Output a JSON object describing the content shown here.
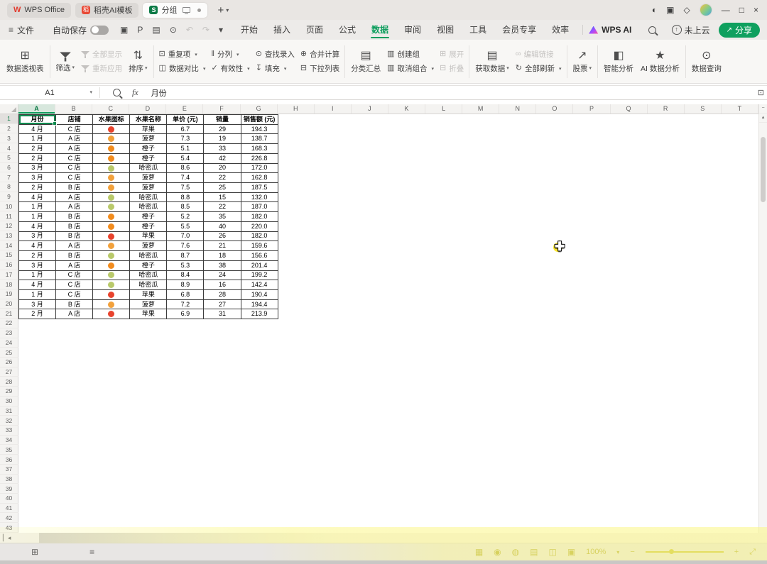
{
  "colors": {
    "accent_green": "#0f9e5e",
    "dark_green": "#0b7a45",
    "selection_green": "#0e8a4f",
    "table_border": "#3c3c3c",
    "fruit": {
      "apple": "#e8432d",
      "pineapple": "#f2a13c",
      "orange": "#f28c1e",
      "melon": "#b9c96a"
    }
  },
  "title_bar": {
    "tabs": [
      {
        "label": "WPS Office",
        "icon": "wps-logo",
        "active": false,
        "badges": []
      },
      {
        "label": "稻壳AI模板",
        "icon": "docer-logo",
        "active": false,
        "badges": []
      },
      {
        "label": "分组",
        "icon": "sheet-doc-logo",
        "active": true,
        "badges": [
          "monitor-icon",
          "unsaved-dot"
        ]
      }
    ],
    "new_tab_glyph": "+",
    "tab_list_caret": "▾",
    "window_icons": [
      {
        "name": "theme-icon",
        "glyph": "◐"
      },
      {
        "name": "layout-icon",
        "glyph": "▣"
      },
      {
        "name": "3d-box-icon",
        "glyph": "◇"
      },
      {
        "name": "avatar",
        "glyph": ""
      },
      {
        "name": "minimize-button",
        "glyph": "—"
      },
      {
        "name": "maximize-button",
        "glyph": "□"
      },
      {
        "name": "close-button",
        "glyph": "×"
      }
    ]
  },
  "menu_bar": {
    "file_label": "文件",
    "autosave_label": "自动保存",
    "quick_access": [
      {
        "name": "save-icon",
        "glyph": "▣",
        "disabled": false
      },
      {
        "name": "export-pdf-icon",
        "glyph": "P",
        "disabled": false
      },
      {
        "name": "print-icon",
        "glyph": "▤",
        "disabled": false
      },
      {
        "name": "print-preview-icon",
        "glyph": "⊙",
        "disabled": false
      },
      {
        "name": "undo-icon",
        "glyph": "↶",
        "disabled": true
      },
      {
        "name": "redo-icon",
        "glyph": "↷",
        "disabled": true
      },
      {
        "name": "quick-access-caret",
        "glyph": "▾",
        "disabled": false
      }
    ],
    "items": [
      "开始",
      "插入",
      "页面",
      "公式",
      "数据",
      "审阅",
      "视图",
      "工具",
      "会员专享",
      "效率"
    ],
    "active_item": "数据",
    "wps_ai_label": "WPS AI",
    "cloud_status": "未上云",
    "share_label": "分享"
  },
  "icon_glyphs": {
    "pivot-table": "⊞",
    "sort": "⇅",
    "duplicates": "⊡",
    "data-compare": "◫",
    "text-to-columns": "‖",
    "validation": "✓",
    "find-entry": "⊙",
    "fill": "↧",
    "consolidate": "⊕",
    "dropdown-list": "⊟",
    "subtotal": "▤",
    "create-group": "▥",
    "ungroup": "▥",
    "expand": "⊞",
    "collapse": "⊟",
    "get-data": "▤",
    "edit-links": "∞",
    "refresh-all": "↻",
    "stock": "↗",
    "smart-analysis": "◧",
    "ai-analysis": "★",
    "data-query": "⊙"
  },
  "ribbon": {
    "buttons": [
      {
        "kind": "big",
        "icon": "pivot-table",
        "label": "数据透视表",
        "arrow": false
      },
      {
        "kind": "sep"
      },
      {
        "kind": "big",
        "icon": "filter",
        "label": "筛选",
        "arrow": true
      },
      {
        "kind": "stack",
        "items": [
          {
            "icon": "filter",
            "label": "全部显示",
            "disabled": true,
            "arrow": false
          },
          {
            "icon": "filter",
            "label": "重新应用",
            "disabled": true,
            "arrow": false
          }
        ]
      },
      {
        "kind": "big",
        "icon": "sort",
        "label": "排序",
        "arrow": true
      },
      {
        "kind": "sep"
      },
      {
        "kind": "stack",
        "items": [
          {
            "icon": "duplicates",
            "label": "重复项",
            "arrow": true,
            "disabled": false
          },
          {
            "icon": "data-compare",
            "label": "数据对比",
            "arrow": true,
            "disabled": false
          }
        ]
      },
      {
        "kind": "stack",
        "items": [
          {
            "icon": "text-to-columns",
            "label": "分列",
            "arrow": true,
            "disabled": false
          },
          {
            "icon": "validation",
            "label": "有效性",
            "arrow": true,
            "disabled": false
          }
        ]
      },
      {
        "kind": "stack",
        "items": [
          {
            "icon": "find-entry",
            "label": "查找录入",
            "arrow": false,
            "disabled": false
          },
          {
            "icon": "fill",
            "label": "填充",
            "arrow": true,
            "disabled": false
          }
        ]
      },
      {
        "kind": "stack",
        "items": [
          {
            "icon": "consolidate",
            "label": "合并计算",
            "arrow": false,
            "disabled": false
          },
          {
            "icon": "dropdown-list",
            "label": "下拉列表",
            "arrow": false,
            "disabled": false
          }
        ]
      },
      {
        "kind": "sep"
      },
      {
        "kind": "big",
        "icon": "subtotal",
        "label": "分类汇总",
        "arrow": false
      },
      {
        "kind": "stack",
        "items": [
          {
            "icon": "create-group",
            "label": "创建组",
            "arrow": false,
            "disabled": false
          },
          {
            "icon": "ungroup",
            "label": "取消组合",
            "arrow": true,
            "disabled": false
          }
        ]
      },
      {
        "kind": "stack",
        "items": [
          {
            "icon": "expand",
            "label": "展开",
            "disabled": true,
            "arrow": false
          },
          {
            "icon": "collapse",
            "label": "折叠",
            "disabled": true,
            "arrow": false
          }
        ]
      },
      {
        "kind": "sep"
      },
      {
        "kind": "big",
        "icon": "get-data",
        "label": "获取数据",
        "arrow": true
      },
      {
        "kind": "stack",
        "items": [
          {
            "icon": "edit-links",
            "label": "编辑链接",
            "disabled": true,
            "arrow": false
          },
          {
            "icon": "refresh-all",
            "label": "全部刷新",
            "arrow": true,
            "disabled": false
          }
        ]
      },
      {
        "kind": "sep"
      },
      {
        "kind": "big",
        "icon": "stock",
        "label": "股票",
        "arrow": true
      },
      {
        "kind": "sep"
      },
      {
        "kind": "big",
        "icon": "smart-analysis",
        "label": "智能分析",
        "arrow": false
      },
      {
        "kind": "big",
        "icon": "ai-analysis",
        "label": "AI 数据分析",
        "arrow": false
      },
      {
        "kind": "sep"
      },
      {
        "kind": "big",
        "icon": "data-query",
        "label": "数据查询",
        "arrow": false
      }
    ]
  },
  "formula_bar": {
    "name_box": "A1",
    "formula_value": "月份"
  },
  "sheet": {
    "columns": [
      "A",
      "B",
      "C",
      "D",
      "E",
      "F",
      "G",
      "H",
      "I",
      "J",
      "K",
      "L",
      "M",
      "N",
      "O",
      "P",
      "Q",
      "R",
      "S",
      "T"
    ],
    "selected_column": "A",
    "active_cell": "A1",
    "row_count": 43,
    "selected_row": 1,
    "table": {
      "headers": [
        "月份",
        "店铺",
        "水果图标",
        "水果名称",
        "单价 (元)",
        "销量",
        "销售额 (元)"
      ],
      "rows": [
        [
          "4 月",
          "C 店",
          "apple",
          "苹果",
          "6.7",
          "29",
          "194.3"
        ],
        [
          "1 月",
          "A 店",
          "pineapple",
          "菠萝",
          "7.3",
          "19",
          "138.7"
        ],
        [
          "2 月",
          "A 店",
          "orange",
          "橙子",
          "5.1",
          "33",
          "168.3"
        ],
        [
          "2 月",
          "C 店",
          "orange",
          "橙子",
          "5.4",
          "42",
          "226.8"
        ],
        [
          "3 月",
          "C 店",
          "melon",
          "哈密瓜",
          "8.6",
          "20",
          "172.0"
        ],
        [
          "3 月",
          "C 店",
          "pineapple",
          "菠萝",
          "7.4",
          "22",
          "162.8"
        ],
        [
          "2 月",
          "B 店",
          "pineapple",
          "菠萝",
          "7.5",
          "25",
          "187.5"
        ],
        [
          "4 月",
          "A 店",
          "melon",
          "哈密瓜",
          "8.8",
          "15",
          "132.0"
        ],
        [
          "1 月",
          "A 店",
          "melon",
          "哈密瓜",
          "8.5",
          "22",
          "187.0"
        ],
        [
          "1 月",
          "B 店",
          "orange",
          "橙子",
          "5.2",
          "35",
          "182.0"
        ],
        [
          "4 月",
          "B 店",
          "orange",
          "橙子",
          "5.5",
          "40",
          "220.0"
        ],
        [
          "3 月",
          "B 店",
          "apple",
          "苹果",
          "7.0",
          "26",
          "182.0"
        ],
        [
          "4 月",
          "A 店",
          "pineapple",
          "菠萝",
          "7.6",
          "21",
          "159.6"
        ],
        [
          "2 月",
          "B 店",
          "melon",
          "哈密瓜",
          "8.7",
          "18",
          "156.6"
        ],
        [
          "3 月",
          "A 店",
          "orange",
          "橙子",
          "5.3",
          "38",
          "201.4"
        ],
        [
          "1 月",
          "C 店",
          "melon",
          "哈密瓜",
          "8.4",
          "24",
          "199.2"
        ],
        [
          "4 月",
          "C 店",
          "melon",
          "哈密瓜",
          "8.9",
          "16",
          "142.4"
        ],
        [
          "1 月",
          "C 店",
          "apple",
          "苹果",
          "6.8",
          "28",
          "190.4"
        ],
        [
          "3 月",
          "B 店",
          "pineapple",
          "菠萝",
          "7.2",
          "27",
          "194.4"
        ],
        [
          "2 月",
          "A 店",
          "apple",
          "苹果",
          "6.9",
          "31",
          "213.9"
        ]
      ]
    }
  },
  "status_bar": {
    "left_icons": [
      {
        "name": "cell-mode-icon",
        "glyph": "⊞"
      },
      {
        "name": "outline-view-icon",
        "glyph": "≡"
      }
    ],
    "right_icons": [
      {
        "name": "table-tools-icon",
        "glyph": "▦"
      },
      {
        "name": "eye-protect-icon",
        "glyph": "◉"
      },
      {
        "name": "macro-record-icon",
        "glyph": "◍"
      },
      {
        "name": "normal-view-icon",
        "glyph": "▤"
      },
      {
        "name": "page-layout-view-icon",
        "glyph": "◫"
      },
      {
        "name": "page-break-view-icon",
        "glyph": "▣"
      }
    ],
    "zoom_level": "100%",
    "zoom_caret": "▾",
    "zoom_out_glyph": "−",
    "zoom_in_glyph": "+",
    "fullscreen_glyph": "⤢"
  }
}
